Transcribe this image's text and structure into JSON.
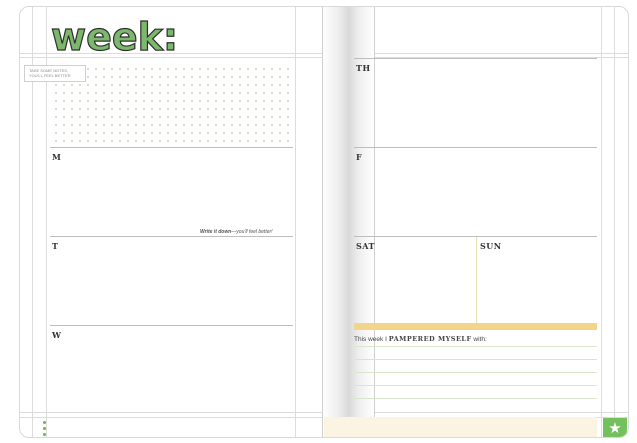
{
  "header": {
    "title": "week:"
  },
  "note_tag": {
    "text": "TAKE SOME NOTES, YOU'LL FEEL BETTER"
  },
  "days_left": [
    {
      "label": "M"
    },
    {
      "label": "T"
    },
    {
      "label": "W"
    }
  ],
  "hint": {
    "bold": "Write it down",
    "rest": "—you'll feel better!"
  },
  "days_right": [
    {
      "label": "TH"
    },
    {
      "label": "F"
    },
    {
      "label": "SAT"
    },
    {
      "label": "SUN"
    }
  ],
  "pamper": {
    "prefix": "This week I",
    "caps": "PAMPERED MYSELF",
    "suffix": "with:"
  },
  "icons": {
    "star": "star-icon",
    "dots": "dots-icon"
  },
  "colors": {
    "accent_green": "#7cb86b",
    "yellow": "#f2d48a",
    "cream": "#fbf4e3"
  }
}
